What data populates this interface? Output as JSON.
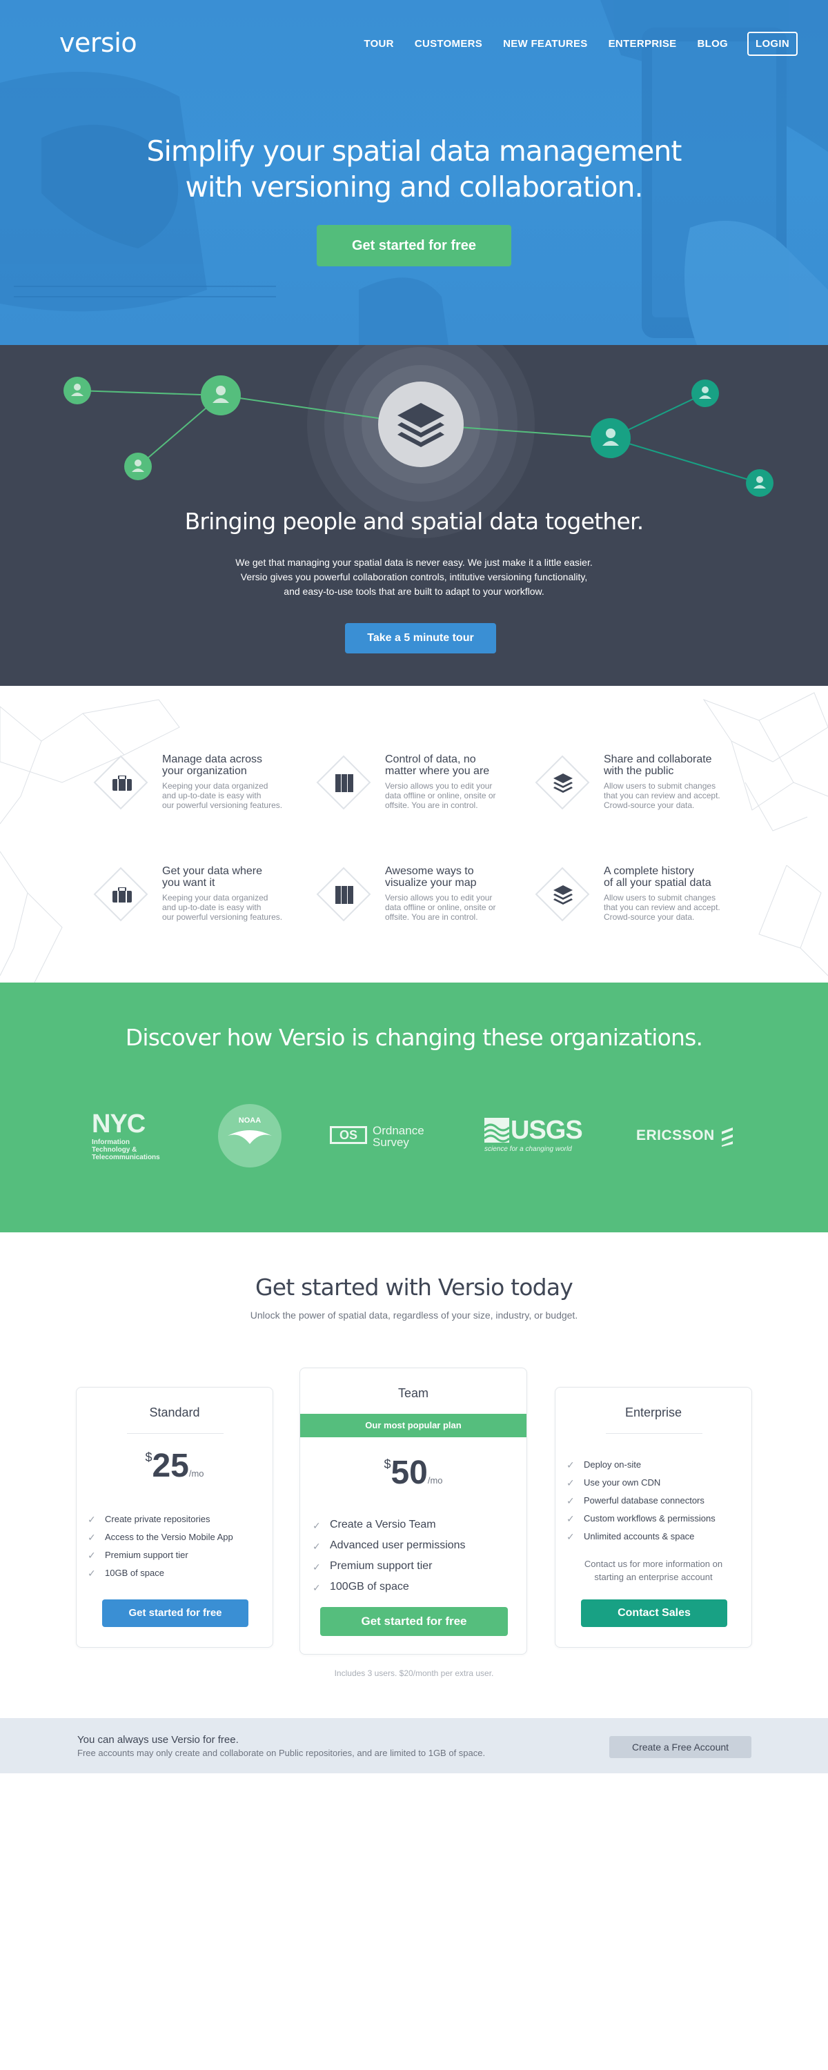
{
  "header": {
    "logo": "versio",
    "nav": [
      "TOUR",
      "CUSTOMERS",
      "NEW FEATURES",
      "ENTERPRISE",
      "BLOG"
    ],
    "login": "LOGIN"
  },
  "hero": {
    "title_line1": "Simplify your spatial data management",
    "title_line2": "with versioning and collaboration.",
    "cta": "Get started for free"
  },
  "network": {
    "title": "Bringing people and spatial data together.",
    "body_line1": "We get that managing your spatial data is never easy. We just make it a little easier.",
    "body_line2": "Versio gives you powerful collaboration controls, intitutive versioning functionality,",
    "body_line3": "and easy-to-use tools that are built to adapt to your workflow.",
    "cta": "Take a 5 minute tour"
  },
  "features": [
    {
      "title_l1": "Manage data across",
      "title_l2": "your organization",
      "icon": "briefcase-icon",
      "desc": [
        "Keeping your data organized",
        "and up-to-date is easy with",
        "our powerful versioning features."
      ]
    },
    {
      "title_l1": "Control of data, no",
      "title_l2": "matter where you are",
      "icon": "book-icon",
      "desc": [
        "Versio allows you to edit your",
        "data offline or online, onsite or",
        "offsite. You are in control."
      ]
    },
    {
      "title_l1": "Share and collaborate",
      "title_l2": "with the public",
      "icon": "layers-icon",
      "desc": [
        "Allow users to submit changes",
        "that you can review and accept.",
        "Crowd-source your data."
      ]
    },
    {
      "title_l1": "Get your data where",
      "title_l2": "you want it",
      "icon": "briefcase-icon",
      "desc": [
        "Keeping your data organized",
        "and up-to-date is easy with",
        "our powerful versioning features."
      ]
    },
    {
      "title_l1": "Awesome ways to",
      "title_l2": "visualize your map",
      "icon": "book-icon",
      "desc": [
        "Versio allows you to edit your",
        "data offline or online, onsite or",
        "offsite. You are in control."
      ]
    },
    {
      "title_l1": "A complete history",
      "title_l2": "of all your spatial data",
      "icon": "layers-icon",
      "desc": [
        "Allow users to submit changes",
        "that you can review and accept.",
        "Crowd-source your data."
      ]
    }
  ],
  "orgs": {
    "title": "Discover how Versio is changing these organizations.",
    "logos": {
      "nyc": "NYC",
      "nyc_sub1": "Information",
      "nyc_sub2": "Technology &",
      "nyc_sub3": "Telecommunications",
      "noaa": "NOAA",
      "os_mark": "OS",
      "os_l1": "Ordnance",
      "os_l2": "Survey",
      "usgs": "USGS",
      "usgs_tag": "science for a changing world",
      "ericsson": "ERICSSON"
    }
  },
  "pricing": {
    "title": "Get started with Versio today",
    "subtitle": "Unlock the power of spatial data, regardless of your size, industry, or budget.",
    "plans": [
      {
        "name": "Standard",
        "currency": "$",
        "amount": "25",
        "per": "/mo",
        "features": [
          "Create private repositories",
          "Access to the Versio Mobile App",
          "Premium support tier",
          "10GB of space"
        ],
        "cta": "Get started for free"
      },
      {
        "name": "Team",
        "badge": "Our most popular plan",
        "currency": "$",
        "amount": "50",
        "per": "/mo",
        "features": [
          "Create a Versio Team",
          "Advanced user permissions",
          "Premium support tier",
          "100GB of space"
        ],
        "cta": "Get started for free"
      },
      {
        "name": "Enterprise",
        "features": [
          "Deploy on-site",
          "Use your own CDN",
          "Powerful database connectors",
          "Custom workflows & permissions",
          "Unlimited accounts & space"
        ],
        "note_l1": "Contact us for more information on",
        "note_l2": "starting an enterprise account",
        "cta": "Contact Sales"
      }
    ],
    "footnote": "Includes 3 users. $20/month per extra user."
  },
  "freebar": {
    "title": "You can always use Versio for free.",
    "body": "Free accounts may only create and collaborate on Public repositories, and are limited to 1GB of space.",
    "cta": "Create a Free Account"
  },
  "colors": {
    "blue": "#3a8fd4",
    "green": "#55be7d",
    "teal": "#18a184",
    "dark": "#3f4655"
  }
}
